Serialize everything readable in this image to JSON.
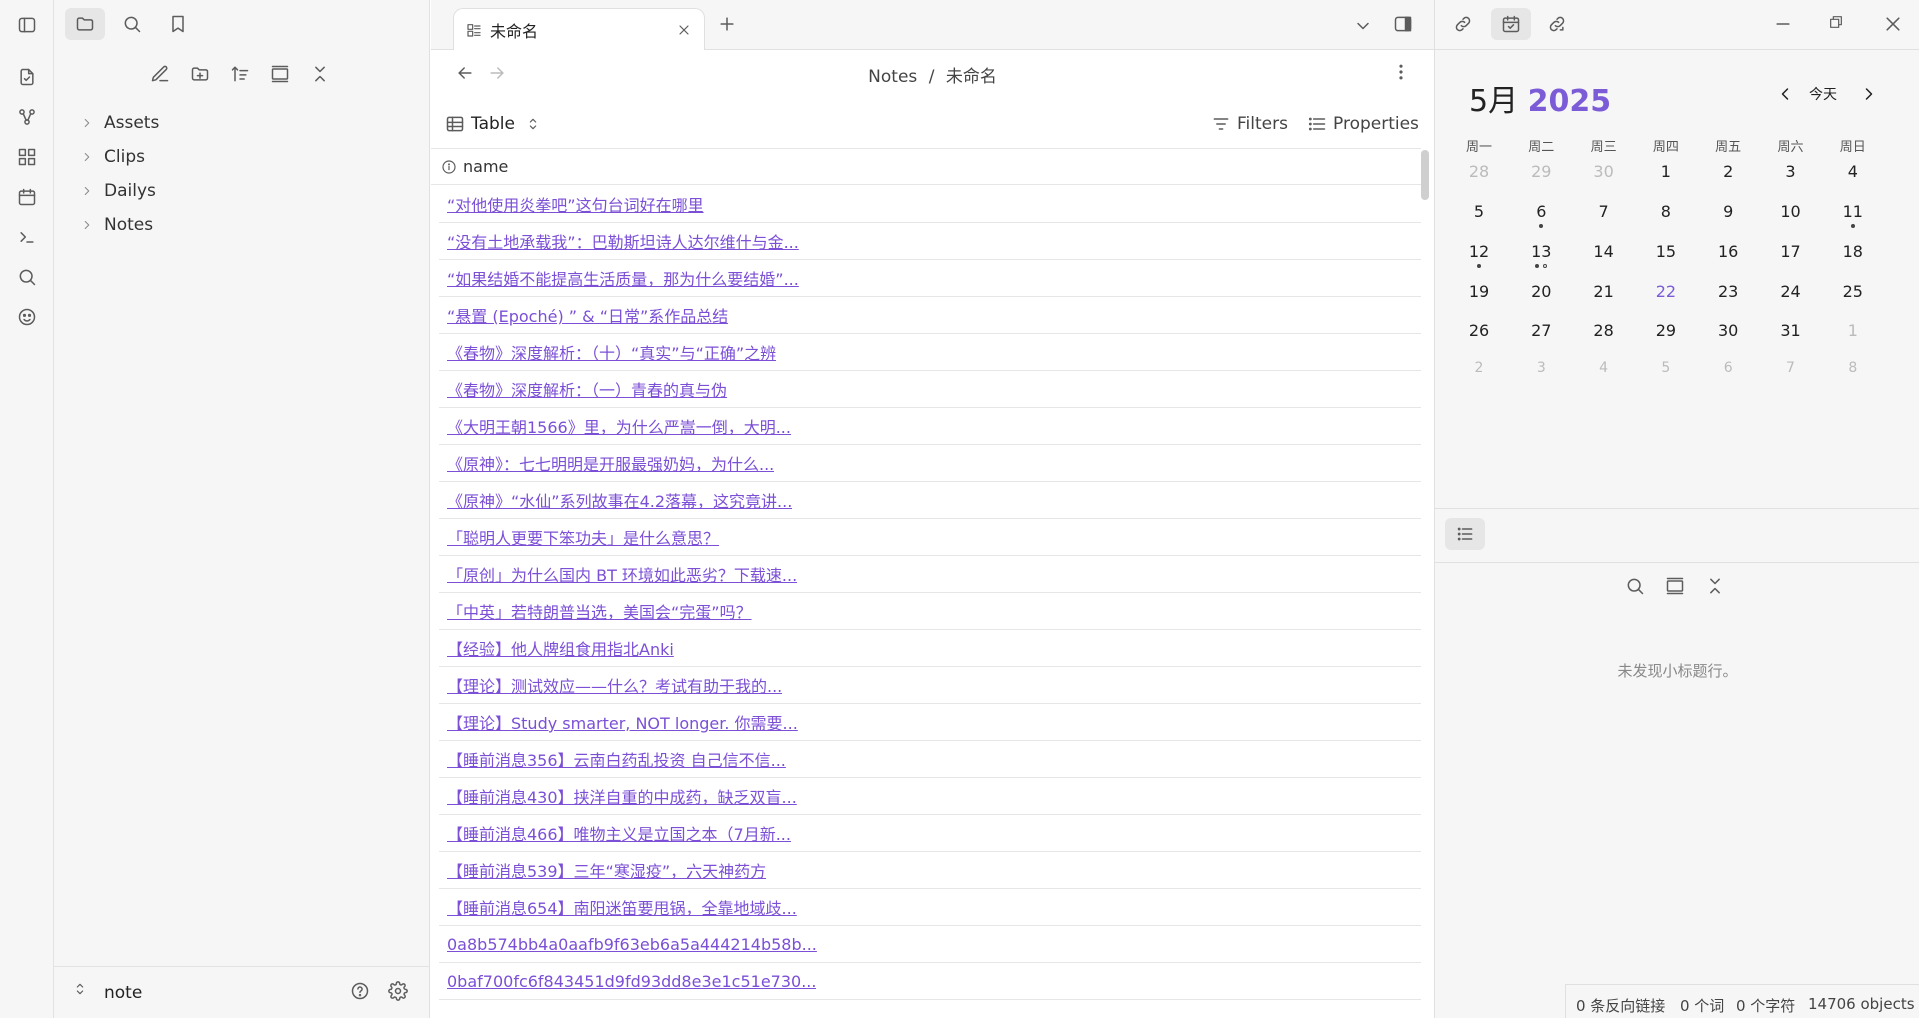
{
  "tab": {
    "title": "未命名"
  },
  "breadcrumb": {
    "folder": "Notes",
    "sep": "/",
    "file": "未命名"
  },
  "view": {
    "type": "Table",
    "filters": "Filters",
    "properties": "Properties",
    "column": "name"
  },
  "sidebar": {
    "items": [
      "Assets",
      "Clips",
      "Dailys",
      "Notes"
    ],
    "vault": "note"
  },
  "rows": [
    "“对他使用炎拳吧”这句台词好在哪里",
    "“没有土地承载我”：巴勒斯坦诗人达尔维什与金...",
    "“如果结婚不能提高生活质量，那为什么要结婚”...",
    "“悬置 (Epoché) ” & “日常”系作品总结",
    "《春物》深度解析：（十）“真实”与“正确”之辨",
    "《春物》深度解析：（一）青春的真与伪",
    "《大明王朝1566》里，为什么严嵩一倒，大明...",
    "《原神》：七七明明是开服最强奶妈，为什么...",
    "《原神》“水仙”系列故事在4.2落幕，这究竟讲...",
    "「聪明人更要下笨功夫」是什么意思？",
    "「原创」为什么国内 BT 环境如此恶劣？下载速...",
    "「中英」若特朗普当选，美国会“完蛋”吗？",
    "【经验】他人牌组食用指北Anki",
    "【理论】测试效应——什么？考试有助于我的...",
    "【理论】Study smarter, NOT longer. 你需要...",
    "【睡前消息356】云南白药乱投资 自己信不信...",
    "【睡前消息430】挟洋自重的中成药，缺乏双盲...",
    "【睡前消息466】唯物主义是立国之本（7月新...",
    "【睡前消息539】三年“寒湿疫”，六天神药方",
    "【睡前消息654】南阳迷笛要甩锅，全靠地域歧...",
    "0a8b574bb4a0aafb9f63eb6a5a444214b58b...",
    "0baf700fc6f843451d9fd93dd8e3e1c51e730..."
  ],
  "calendar": {
    "month": "5月",
    "year": "2025",
    "today_btn": "今天",
    "weekdays": [
      "周一",
      "周二",
      "周三",
      "周四",
      "周五",
      "周六",
      "周日"
    ],
    "weeks": [
      [
        "28",
        "29",
        "30",
        "1",
        "2",
        "3",
        "4"
      ],
      [
        "5",
        "6",
        "7",
        "8",
        "9",
        "10",
        "11"
      ],
      [
        "12",
        "13",
        "14",
        "15",
        "16",
        "17",
        "18"
      ],
      [
        "19",
        "20",
        "21",
        "22",
        "23",
        "24",
        "25"
      ],
      [
        "26",
        "27",
        "28",
        "29",
        "30",
        "31",
        "1"
      ],
      [
        "2",
        "3",
        "4",
        "5",
        "6",
        "7",
        "8"
      ]
    ],
    "accent": "#7b5cd6"
  },
  "outline": {
    "empty": "未发现小标题行。"
  },
  "statusbar": {
    "backlinks": "0 条反向链接",
    "words": "0 个词",
    "chars": "0 个字符",
    "objects": "14706 objects"
  }
}
